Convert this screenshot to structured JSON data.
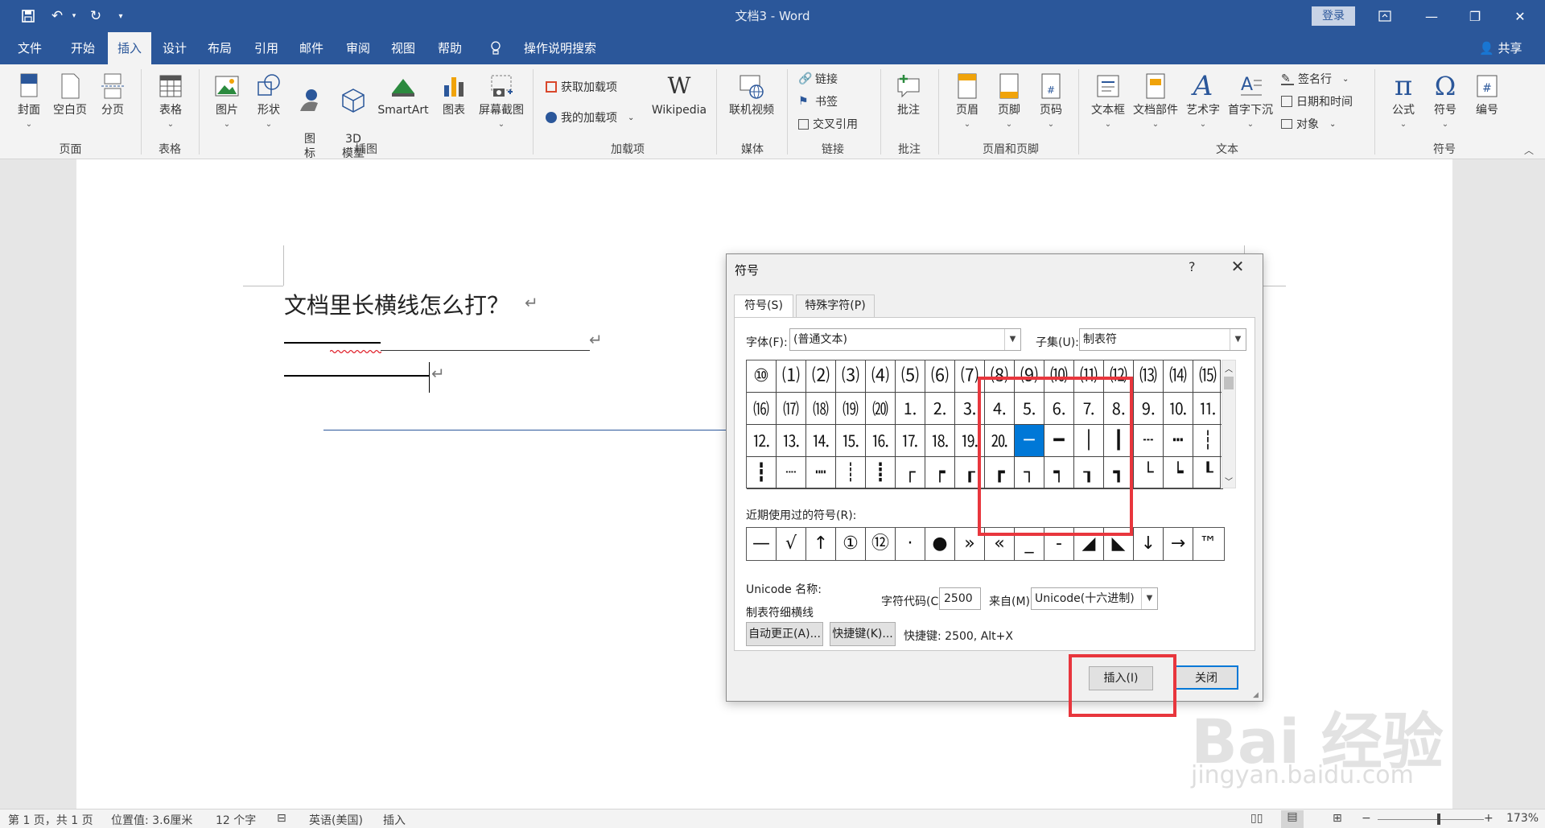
{
  "window": {
    "title": "文档3  -  Word",
    "login_label": "登录",
    "share_label": "共享"
  },
  "tabs": [
    {
      "label": "文件"
    },
    {
      "label": "开始"
    },
    {
      "label": "插入"
    },
    {
      "label": "设计"
    },
    {
      "label": "布局"
    },
    {
      "label": "引用"
    },
    {
      "label": "邮件"
    },
    {
      "label": "审阅"
    },
    {
      "label": "视图"
    },
    {
      "label": "帮助"
    }
  ],
  "tell_me": "操作说明搜索",
  "ribbon": {
    "cover": "封面",
    "blank": "空白页",
    "pagebreak": "分页",
    "group_pages": "页面",
    "table": "表格",
    "group_table": "表格",
    "picture": "图片",
    "shapes": "形状",
    "icons": "图\n标",
    "model3d": "3D\n模型",
    "smartart": "SmartArt",
    "chart": "图表",
    "screenshot": "屏幕截图",
    "group_illustrations": "插图",
    "get_addins": "获取加载项",
    "my_addins": "我的加载项",
    "wikipedia": "Wikipedia",
    "group_addins": "加载项",
    "online_video": "联机视频",
    "group_media": "媒体",
    "link": "链接",
    "bookmark": "书签",
    "crossref": "交叉引用",
    "group_links": "链接",
    "comment": "批注",
    "group_comments": "批注",
    "header": "页眉",
    "footer": "页脚",
    "pagenum": "页码",
    "group_headerfooter": "页眉和页脚",
    "textbox": "文本框",
    "quickparts": "文档部件",
    "wordart": "艺术字",
    "dropcap": "首字下沉",
    "signature": "签名行",
    "datetime": "日期和时间",
    "object": "对象",
    "group_text": "文本",
    "equation": "公式",
    "symbol": "符号",
    "number": "编号",
    "group_symbols": "符号"
  },
  "document": {
    "heading": "文档里长横线怎么打？"
  },
  "dialog": {
    "title": "符号",
    "help": "?",
    "tab_symbols": "符号(S)",
    "tab_special": "特殊字符(P)",
    "font_label": "字体(F):",
    "font_value": "(普通文本)",
    "subset_label": "子集(U):",
    "subset_value": "制表符",
    "grid_rows": [
      [
        "⑩",
        "⑴",
        "⑵",
        "⑶",
        "⑷",
        "⑸",
        "⑹",
        "⑺",
        "⑻",
        "⑼",
        "⑽",
        "⑾",
        "⑿",
        "⒀",
        "⒁",
        "⒂"
      ],
      [
        "⒃",
        "⒄",
        "⒅",
        "⒆",
        "⒇",
        "⒈",
        "⒉",
        "⒊",
        "⒋",
        "⒌",
        "⒍",
        "⒎",
        "⒏",
        "⒐",
        "⒑",
        "⒒"
      ],
      [
        "⒓",
        "⒔",
        "⒕",
        "⒖",
        "⒗",
        "⒘",
        "⒙",
        "⒚",
        "⒛",
        "─",
        "━",
        "│",
        "┃",
        "┄",
        "┅",
        "┆"
      ],
      [
        "┇",
        "┈",
        "┉",
        "┊",
        "┋",
        "┌",
        "┍",
        "┎",
        "┏",
        "┐",
        "┑",
        "┒",
        "┓",
        "└",
        "┕",
        "┖"
      ]
    ],
    "selected_cell": "─",
    "recent_label": "近期使用过的符号(R):",
    "recent": [
      "—",
      "√",
      "↑",
      "①",
      "⑫",
      "·",
      "●",
      "»",
      "«",
      "_",
      "-",
      "◢",
      "◣",
      "↓",
      "→",
      "™"
    ],
    "unicode_name_label": "Unicode 名称:",
    "unicode_name_value": "制表符细横线",
    "char_code_label": "字符代码(C):",
    "char_code_value": "2500",
    "from_label": "来自(M):",
    "from_value": "Unicode(十六进制)",
    "autocorrect_btn": "自动更正(A)...",
    "shortcut_btn": "快捷键(K)...",
    "shortcut_text": "快捷键: 2500, Alt+X",
    "insert_btn": "插入(I)",
    "close_btn": "关闭"
  },
  "watermark": {
    "brand": "Bai 经验",
    "url": "jingyan.baidu.com"
  },
  "status": {
    "page": "第 1 页，共 1 页",
    "position": "位置值: 3.6厘米",
    "words": "12 个字",
    "language": "英语(美国)",
    "mode": "插入",
    "zoom": "173%"
  },
  "colors": {
    "brand_blue": "#2b579a",
    "highlight_red": "#e8363d",
    "selection_blue": "#0078d7"
  }
}
